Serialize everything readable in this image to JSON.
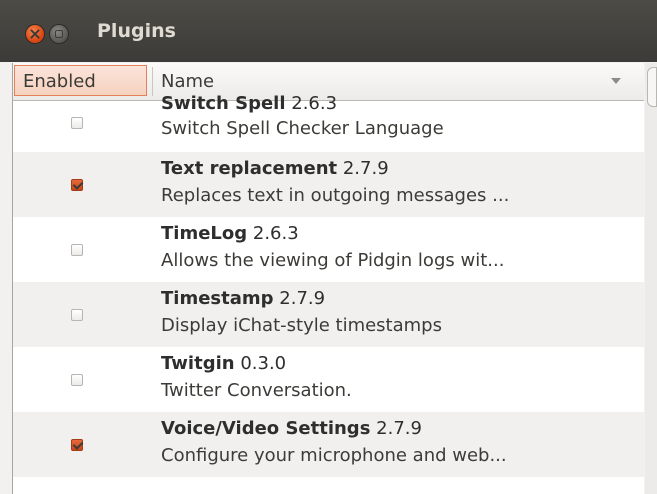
{
  "window": {
    "title": "Plugins"
  },
  "columns": {
    "enabled": "Enabled",
    "name": "Name"
  },
  "plugins": [
    {
      "name": "Switch Spell",
      "version": "2.6.3",
      "description": "Switch Spell Checker Language",
      "enabled": false
    },
    {
      "name": "Text replacement",
      "version": "2.7.9",
      "description": "Replaces text in outgoing messages ...",
      "enabled": true
    },
    {
      "name": "TimeLog",
      "version": "2.6.3",
      "description": "Allows the viewing of Pidgin logs wit...",
      "enabled": false
    },
    {
      "name": "Timestamp",
      "version": "2.7.9",
      "description": "Display iChat-style timestamps",
      "enabled": false
    },
    {
      "name": "Twitgin",
      "version": "0.3.0",
      "description": "Twitter Conversation.",
      "enabled": false
    },
    {
      "name": "Voice/Video Settings",
      "version": "2.7.9",
      "description": "Configure your microphone and web...",
      "enabled": true
    }
  ],
  "colors": {
    "titlebar": "#3c3b37",
    "accent": "#dd4814",
    "row_alt": "#f1f0ee"
  },
  "icons": {
    "close": "close-icon",
    "minimize": "minimize-icon",
    "sort": "chevron-down-icon"
  }
}
